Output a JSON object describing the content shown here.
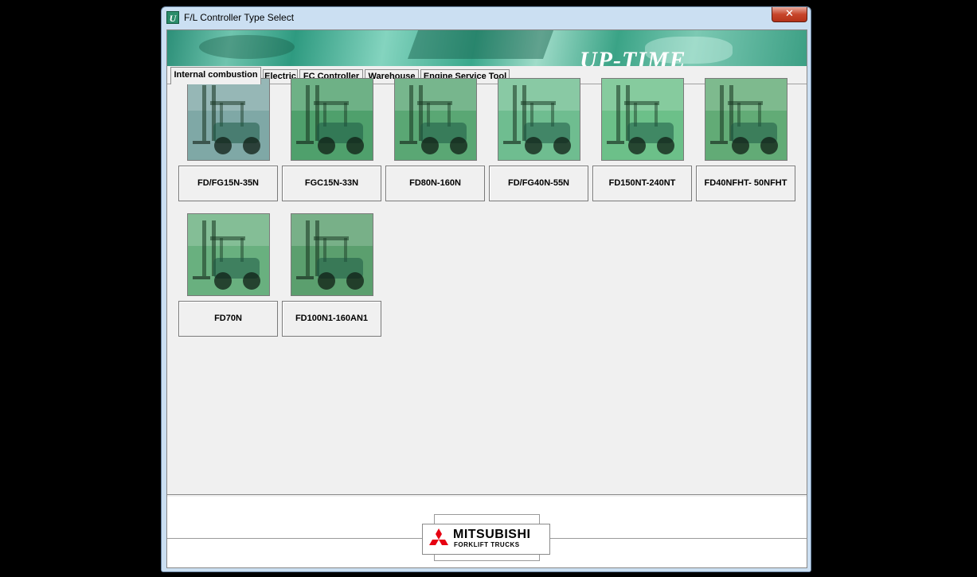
{
  "window": {
    "title": "F/L Controller Type Select",
    "icon_name": "app-u-icon",
    "close_label": "✕"
  },
  "banner": {
    "text": "UP-TIME"
  },
  "tabs": [
    {
      "label": "Internal combustion",
      "active": true
    },
    {
      "label": "Electric",
      "active": false
    },
    {
      "label": "FC Controller",
      "active": false
    },
    {
      "label": "Warehouse",
      "active": false
    },
    {
      "label": "Engine Service Tool",
      "active": false
    }
  ],
  "models": [
    {
      "label": "FD/FG15N-35N",
      "image_icon": "forklift-photo-icon"
    },
    {
      "label": "FGC15N-33N",
      "image_icon": "forklift-photo-icon"
    },
    {
      "label": "FD80N-160N",
      "image_icon": "forklift-photo-icon"
    },
    {
      "label": "FD/FG40N-55N",
      "image_icon": "forklift-photo-icon"
    },
    {
      "label": "FD150NT-240NT",
      "image_icon": "forklift-photo-icon"
    },
    {
      "label": "FD40NFHT- 50NFHT",
      "image_icon": "forklift-photo-icon"
    },
    {
      "label": "FD70N",
      "image_icon": "forklift-photo-icon"
    },
    {
      "label": "FD100N1-160AN1",
      "image_icon": "forklift-photo-icon"
    }
  ],
  "footer": {
    "logo_title": "MITSUBISHI",
    "logo_subtitle": "FORKLIFT TRUCKS"
  },
  "colors": {
    "banner_green": "#3aa88c",
    "photo_tint": "#5fae7f",
    "logo_red": "#e60012"
  }
}
